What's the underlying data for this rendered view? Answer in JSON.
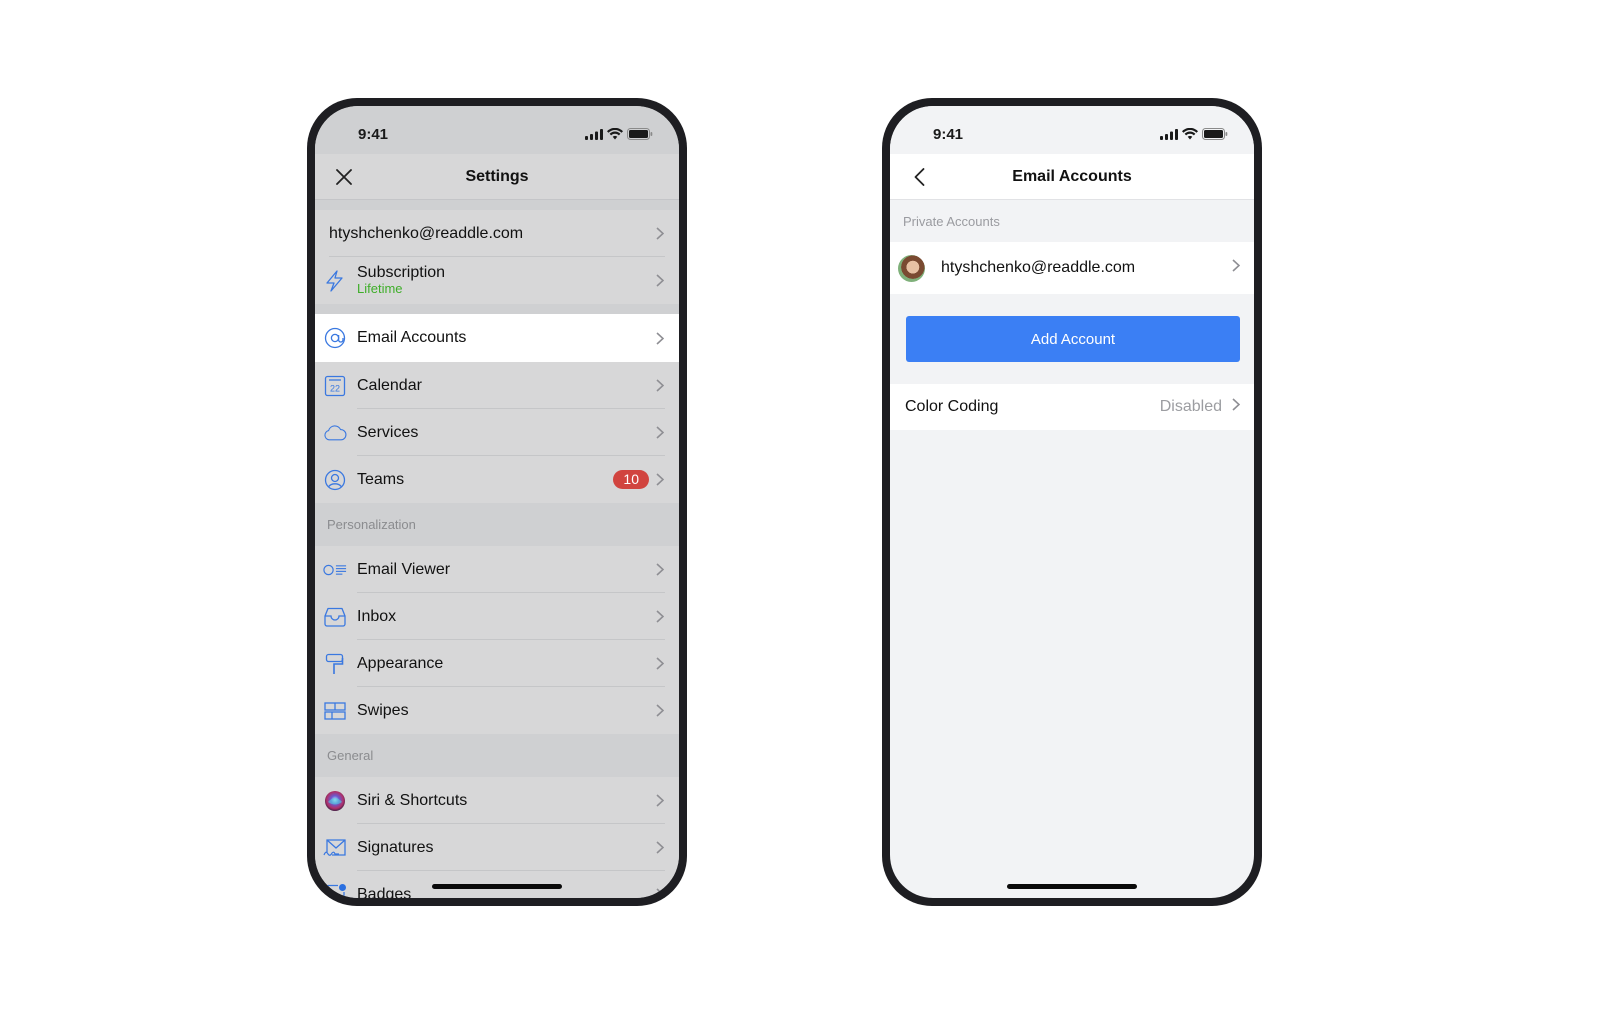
{
  "left_phone": {
    "status_bar": {
      "time": "9:41",
      "icons": [
        "signal-icon",
        "wifi-icon",
        "battery-icon"
      ]
    },
    "navbar": {
      "title": "Settings",
      "left_icon": "close-icon"
    },
    "groups": [
      {
        "items": [
          {
            "label": "htyshchenko@readdle.com",
            "icon": null
          },
          {
            "label": "Subscription",
            "sublabel": "Lifetime",
            "icon": "lightning-icon"
          }
        ]
      },
      {
        "items": [
          {
            "label": "Email Accounts",
            "icon": "at-icon",
            "selected": true
          },
          {
            "label": "Calendar",
            "icon": "calendar-icon",
            "icon_text": "22"
          },
          {
            "label": "Services",
            "icon": "cloud-icon"
          },
          {
            "label": "Teams",
            "icon": "person-icon",
            "badge": "10"
          }
        ]
      },
      {
        "header": "Personalization",
        "items": [
          {
            "label": "Email Viewer",
            "icon": "email-viewer-icon"
          },
          {
            "label": "Inbox",
            "icon": "inbox-tray-icon"
          },
          {
            "label": "Appearance",
            "icon": "paint-roller-icon"
          },
          {
            "label": "Swipes",
            "icon": "swipes-grid-icon"
          }
        ]
      },
      {
        "header": "General",
        "items": [
          {
            "label": "Siri & Shortcuts",
            "icon": "siri-icon"
          },
          {
            "label": "Signatures",
            "icon": "signature-icon"
          },
          {
            "label": "Badges",
            "icon": "badge-dot-icon"
          }
        ]
      }
    ]
  },
  "right_phone": {
    "status_bar": {
      "time": "9:41",
      "icons": [
        "signal-icon",
        "wifi-icon",
        "battery-icon"
      ]
    },
    "navbar": {
      "title": "Email Accounts",
      "left_icon": "back-chevron-icon"
    },
    "section_label": "Private Accounts",
    "account": {
      "email": "htyshchenko@readdle.com",
      "avatar": "avatar-photo"
    },
    "add_account_label": "Add Account",
    "color_coding": {
      "label": "Color Coding",
      "value": "Disabled"
    }
  },
  "colors": {
    "accent_blue": "#3b7ff4",
    "icon_blue": "#3a78e0",
    "badge_red": "#d1443f",
    "lifetime_green": "#3fae2a"
  }
}
